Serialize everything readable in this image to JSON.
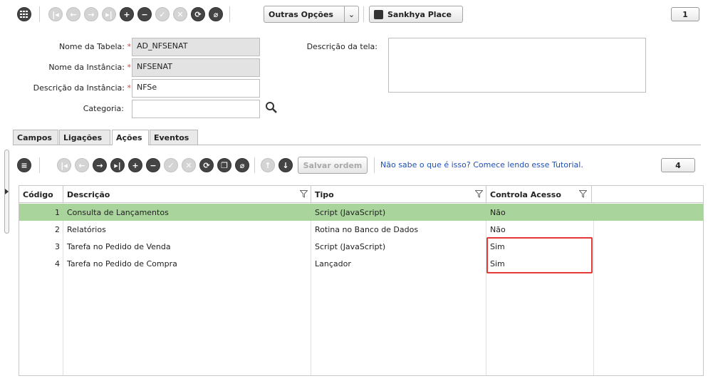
{
  "toolbar": {
    "other_options_label": "Outras Opções",
    "place_label": "Sankhya Place",
    "page_number": "1"
  },
  "form": {
    "table_name_label": "Nome da Tabela:",
    "table_name_value": "AD_NFSENAT",
    "instance_name_label": "Nome da Instância:",
    "instance_name_value": "NFSENAT",
    "instance_desc_label": "Descrição da Instância:",
    "instance_desc_value": "NFSe",
    "category_label": "Categoria:",
    "category_value": "",
    "screen_desc_label": "Descrição da tela:",
    "screen_desc_value": "",
    "required_mark": "*"
  },
  "tabs": [
    {
      "label": "Campos"
    },
    {
      "label": "Ligações"
    },
    {
      "label": "Ações"
    },
    {
      "label": "Eventos"
    }
  ],
  "actions_toolbar": {
    "save_order_label": "Salvar ordem",
    "tutorial_link": "Não sabe o que é isso? Comece lendo esse Tutorial.",
    "count": "4"
  },
  "grid": {
    "headers": {
      "code": "Código",
      "description": "Descrição",
      "type": "Tipo",
      "access": "Controla Acesso"
    },
    "rows": [
      {
        "code": "1",
        "description": "Consulta de Lançamentos",
        "type": "Script (JavaScript)",
        "access": "Não"
      },
      {
        "code": "2",
        "description": "Relatórios",
        "type": "Rotina no Banco de Dados",
        "access": "Não"
      },
      {
        "code": "3",
        "description": "Tarefa no Pedido de Venda",
        "type": "Script (JavaScript)",
        "access": "Sim"
      },
      {
        "code": "4",
        "description": "Tarefa no Pedido de Compra",
        "type": "Lançador",
        "access": "Sim"
      }
    ]
  },
  "colors": {
    "selected_row": "#a9d49c",
    "highlight_border": "#e53935",
    "link": "#1f4fb5"
  }
}
